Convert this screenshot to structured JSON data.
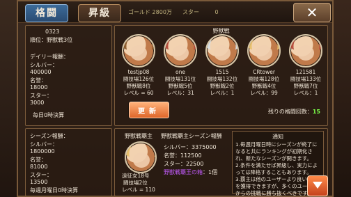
{
  "tabs": [
    {
      "label": "格闘"
    },
    {
      "label": "昇級"
    }
  ],
  "header": {
    "gold_label": "ゴールド",
    "gold_value": "2800万",
    "star_label": "スター",
    "star_value": "0"
  },
  "left_top": {
    "player_id": "0323",
    "rank_line": "順位：野獣戦3位",
    "daily_title": "デイリー報酬：",
    "silver_label": "シルバー：",
    "silver_value": "400000",
    "fame_label": "名誉：",
    "fame_value": "18000",
    "star_label": "スター：",
    "star_value": "3000",
    "daily_settle": "毎日0時決算"
  },
  "main_top": {
    "title": "野獣戦",
    "opponents": [
      {
        "name": "testjp08",
        "arena_rank": "闘技場126位",
        "beast_rank": "野獣戦8位",
        "level": "レベル = 60",
        "avatar_style": "brown"
      },
      {
        "name": "one",
        "arena_rank": "闘技場131位",
        "beast_rank": "野獣戦5位",
        "level": "レベル：31",
        "avatar_style": "red"
      },
      {
        "name": "1515",
        "arena_rank": "闘技場132位",
        "beast_rank": "野獣戦2位",
        "level": "レベル：1",
        "avatar_style": "silver"
      },
      {
        "name": "CRtower",
        "arena_rank": "闘技場128位",
        "beast_rank": "野獣戦4位",
        "level": "レベル：99",
        "avatar_style": "blonde"
      },
      {
        "name": "121581",
        "arena_rank": "闘技場133位",
        "beast_rank": "野獣戦7位",
        "level": "レベル：1",
        "avatar_style": "red"
      }
    ],
    "update_label": "更新",
    "remaining_label": "残りの格闘回数：",
    "remaining_value": "15"
  },
  "left_bottom": {
    "season_title": "シーズン報酬：",
    "silver_label": "シルバー：",
    "silver_value": "1800000",
    "fame_label": "名誉：",
    "fame_value": "81000",
    "star_label": "スター：",
    "star_value": "13500",
    "weekly_settle": "毎週月曜日0時決算"
  },
  "main_bottom": {
    "champion_title": "野獣戦覇主",
    "season_reward_title": "野獣戦覇主シーズン報酬",
    "champion": {
      "name": "遠征女18号",
      "arena_rank": "闘技場2位",
      "level": "レベル = 110"
    },
    "reward_lines": {
      "silver": "シルバー：3375000",
      "fame": "名誉：112500",
      "star": "スター：22500",
      "box_label": "野獣戦覇王の箱",
      "box_qty": "：1個"
    },
    "notice": {
      "title": "通知",
      "lines": [
        "1.毎週月曜日時にシーズンが終了になると共にランキングが初期化され、新たなシーズンが開きます。",
        "2.条件を満たせば昇級し、実力によっては降格することもあります。",
        "3.覇主は他のユーザーより良い報酬を獲得できますが、多くのユーザーからの挑戦に勝ち抜くべきです。"
      ]
    }
  },
  "icons": {
    "close": "close-icon",
    "down": "arrow-down-icon"
  },
  "colors": {
    "accent_green": "#7cff4a",
    "button_orange": "#e0662a",
    "link_purple": "#c45cff"
  }
}
